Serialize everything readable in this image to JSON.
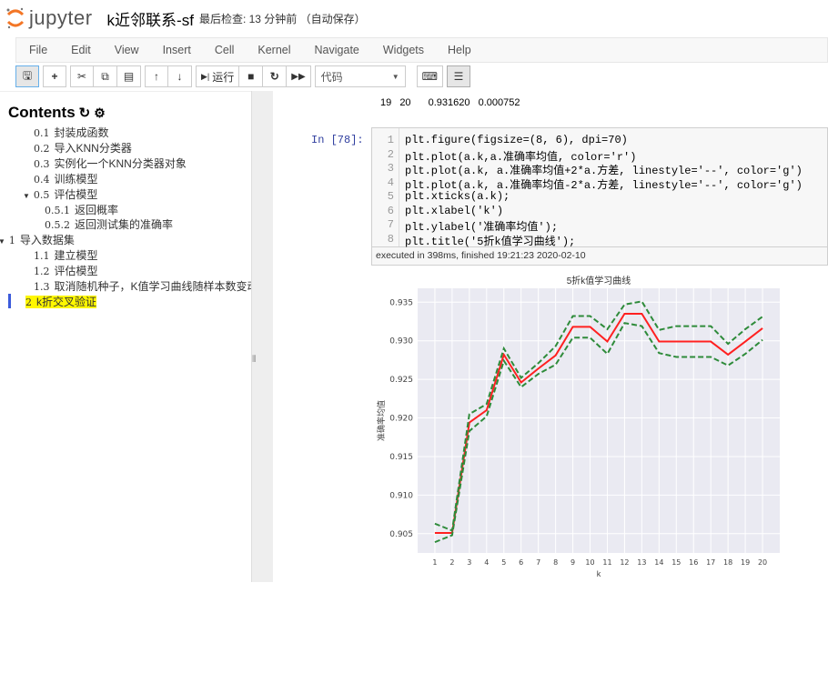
{
  "header": {
    "logo_text": "jupyter",
    "notebook_name": "k近邻联系-sf",
    "checkpoint": "最后检查: 13 分钟前 （自动保存）"
  },
  "menu": [
    "File",
    "Edit",
    "View",
    "Insert",
    "Cell",
    "Kernel",
    "Navigate",
    "Widgets",
    "Help"
  ],
  "toolbar": {
    "run_label": "运行",
    "cell_type": "代码"
  },
  "toc": {
    "title": "Contents",
    "items": [
      {
        "num": "0.1",
        "label": "封装成函数",
        "level": 1
      },
      {
        "num": "0.2",
        "label": "导入KNN分类器",
        "level": 1
      },
      {
        "num": "0.3",
        "label": "实例化一个KNN分类器对象",
        "level": 1
      },
      {
        "num": "0.4",
        "label": "训练模型",
        "level": 1
      },
      {
        "num": "0.5",
        "label": "评估模型",
        "level": 1,
        "caret": true
      },
      {
        "num": "0.5.1",
        "label": "返回概率",
        "level": 2
      },
      {
        "num": "0.5.2",
        "label": "返回测试集的准确率",
        "level": 2
      },
      {
        "num": "1",
        "label": "导入数据集",
        "level": 0,
        "caret": true
      },
      {
        "num": "1.1",
        "label": "建立模型",
        "level": 1
      },
      {
        "num": "1.2",
        "label": "评估模型",
        "level": 1
      },
      {
        "num": "1.3",
        "label": "取消随机种子，K值学习曲线随样本数变动",
        "level": 1
      },
      {
        "num": "2",
        "label": "k折交叉验证",
        "level": 0,
        "active": true
      }
    ]
  },
  "output_row": {
    "index": "19",
    "k": "20",
    "mean": "0.931620",
    "var": "0.000752"
  },
  "cell": {
    "prompt": "In  [78]:",
    "line_numbers": [
      "1",
      "2",
      "3",
      "4",
      "5",
      "6",
      "7",
      "8"
    ],
    "lines": [
      "plt.figure(figsize=(8, 6), dpi=70)",
      "plt.plot(a.k,a.准确率均值, color='r')",
      "plt.plot(a.k, a.准确率均值+2*a.方差, linestyle='--', color='g')",
      "plt.plot(a.k, a.准确率均值-2*a.方差, linestyle='--', color='g')",
      "plt.xticks(a.k);",
      "plt.xlabel('k')",
      "plt.ylabel('准确率均值');",
      "plt.title('5折k值学习曲线');"
    ],
    "exec_info": "executed in 398ms, finished 19:21:23 2020-02-10"
  },
  "chart_data": {
    "type": "line",
    "title": "5折k值学习曲线",
    "xlabel": "k",
    "ylabel": "准确率均值",
    "x": [
      1,
      2,
      3,
      4,
      5,
      6,
      7,
      8,
      9,
      10,
      11,
      12,
      13,
      14,
      15,
      16,
      17,
      18,
      19,
      20
    ],
    "series": [
      {
        "name": "准确率均值",
        "color": "#ff2020",
        "style": "solid",
        "values": [
          0.9051,
          0.9051,
          0.9194,
          0.921,
          0.9282,
          0.9246,
          0.9264,
          0.9281,
          0.9318,
          0.9318,
          0.9299,
          0.9335,
          0.9335,
          0.9299,
          0.9299,
          0.9299,
          0.9299,
          0.9282,
          0.9299,
          0.93162
        ]
      },
      {
        "name": "准确率均值+2*方差",
        "color": "#2e8b3a",
        "style": "dashed",
        "values": [
          0.9063,
          0.9054,
          0.9205,
          0.9218,
          0.929,
          0.9252,
          0.9271,
          0.9293,
          0.9332,
          0.9332,
          0.9315,
          0.9347,
          0.9351,
          0.9314,
          0.9319,
          0.9319,
          0.9319,
          0.9296,
          0.9315,
          0.933124
        ]
      },
      {
        "name": "准确率均值-2*方差",
        "color": "#2e8b3a",
        "style": "dashed",
        "values": [
          0.9039,
          0.9048,
          0.9183,
          0.9202,
          0.9274,
          0.924,
          0.9257,
          0.9269,
          0.9304,
          0.9304,
          0.9283,
          0.9323,
          0.9319,
          0.9284,
          0.9279,
          0.9279,
          0.9279,
          0.9268,
          0.9283,
          0.930116
        ]
      }
    ],
    "yticks": [
      "0.905",
      "0.910",
      "0.915",
      "0.920",
      "0.925",
      "0.930",
      "0.935"
    ],
    "ytick_values": [
      0.905,
      0.91,
      0.915,
      0.92,
      0.925,
      0.93,
      0.935
    ],
    "ylim": [
      0.9025,
      0.9368
    ],
    "xlim": [
      0,
      21
    ],
    "grid": true,
    "background": "#eaeaf2"
  }
}
